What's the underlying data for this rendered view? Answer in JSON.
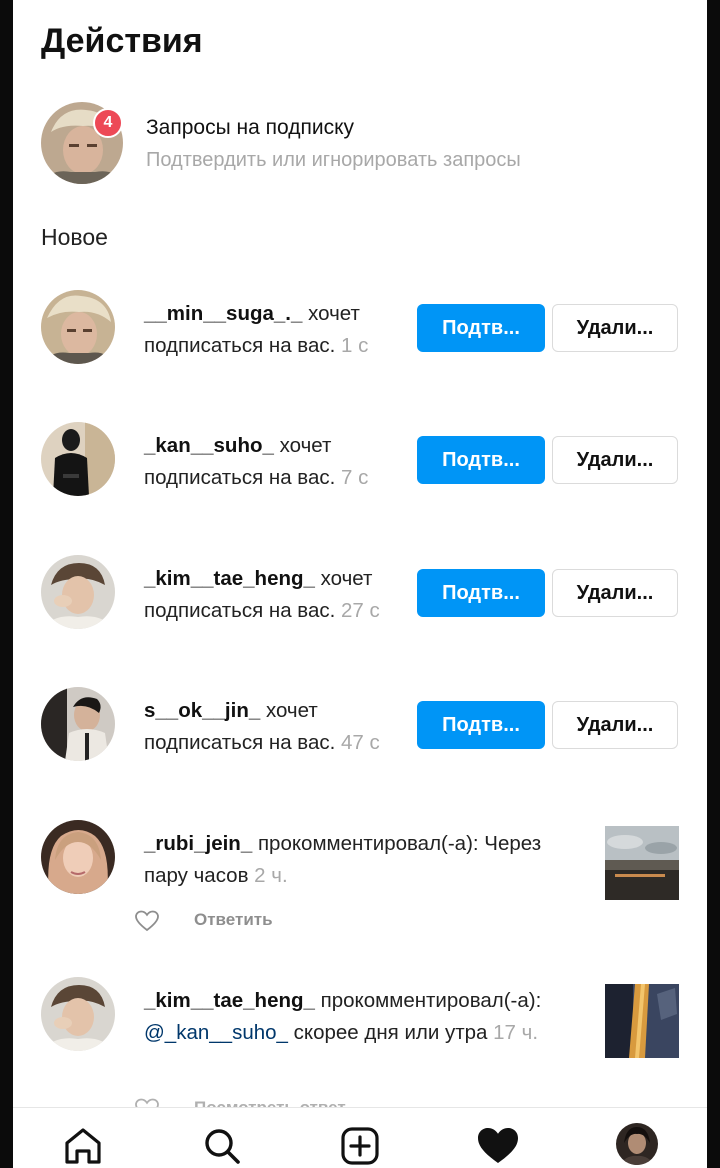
{
  "header": {
    "title": "Действия"
  },
  "follow_requests": {
    "title": "Запросы на подписку",
    "subtitle": "Подтвердить или игнорировать запросы",
    "badge_count": "4"
  },
  "section_new": "Новое",
  "requests": [
    {
      "username": "__min__suga_._",
      "action": " хочет подписаться на вас. ",
      "time": "1 с",
      "confirm_label": "Подтв...",
      "delete_label": "Удали..."
    },
    {
      "username": "_kan__suho_",
      "action": " хочет подписаться на вас. ",
      "time": "7 с",
      "confirm_label": "Подтв...",
      "delete_label": "Удали..."
    },
    {
      "username": "_kim__tae_heng_",
      "action": " хочет подписаться на вас. ",
      "time": "27 с",
      "confirm_label": "Подтв...",
      "delete_label": "Удали..."
    },
    {
      "username": "s__ok__jin_",
      "action": " хочет подписаться на вас. ",
      "time": "47 с",
      "confirm_label": "Подтв...",
      "delete_label": "Удали..."
    }
  ],
  "comments": [
    {
      "username": "_rubi_jein_",
      "action": " прокомментировал(-а): ",
      "text": "Через пару часов ",
      "time": "2 ч.",
      "reply_label": "Ответить"
    },
    {
      "username": "_kim__tae_heng_",
      "action": " прокомментировал(-а): ",
      "mention": "@_kan__suho_",
      "text": " скорее дня или утра ",
      "time": "17 ч.",
      "reply_label": "Посмотреть ответ"
    }
  ],
  "bottom_nav": [
    "home-icon",
    "search-icon",
    "new-post-icon",
    "activity-icon",
    "profile-avatar"
  ],
  "colors": {
    "accent": "#0095f6",
    "badge": "#ed4956",
    "secondary_text": "#a8a8a8",
    "mention": "#00376b"
  }
}
